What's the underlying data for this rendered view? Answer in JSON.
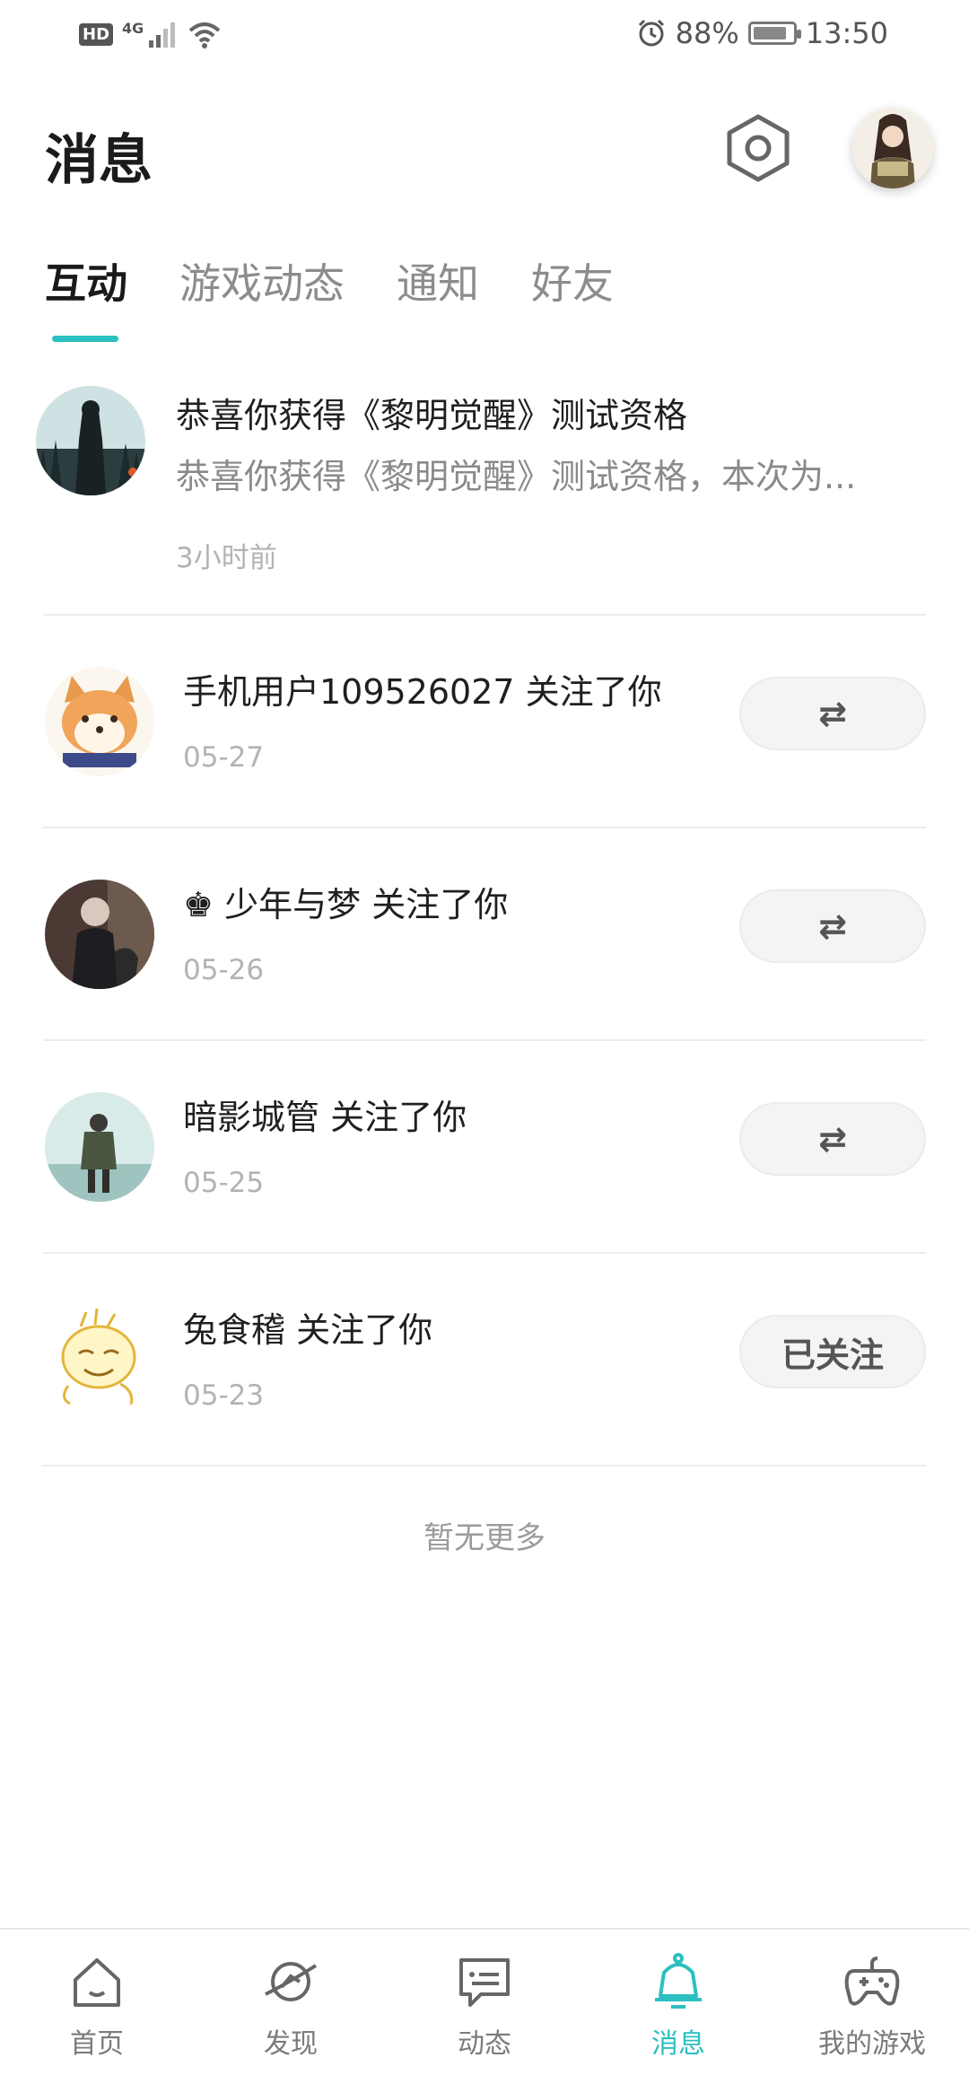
{
  "status_bar": {
    "hd": "HD",
    "network": "4G",
    "battery_percent": "88%",
    "battery_level": 0.88,
    "time": "13:50"
  },
  "header": {
    "title": "消息"
  },
  "tabs": [
    {
      "label": "互动",
      "active": true
    },
    {
      "label": "游戏动态",
      "active": false
    },
    {
      "label": "通知",
      "active": false
    },
    {
      "label": "好友",
      "active": false
    }
  ],
  "messages": [
    {
      "type": "system",
      "title": "恭喜你获得《黎明觉醒》测试资格",
      "subtitle": "恭喜你获得《黎明觉醒》测试资格，本次为...",
      "time": "3小时前"
    },
    {
      "type": "follow",
      "title": "手机用户109526027 关注了你",
      "time": "05-27",
      "button": "⇄",
      "button_icon": "mutual-follow-icon"
    },
    {
      "type": "follow",
      "title": "♚ 少年与梦 关注了你",
      "time": "05-26",
      "button": "⇄",
      "button_icon": "mutual-follow-icon"
    },
    {
      "type": "follow",
      "title": "暗影城管 关注了你",
      "time": "05-25",
      "button": "⇄",
      "button_icon": "mutual-follow-icon"
    },
    {
      "type": "follow",
      "title": "兔食稽 关注了你",
      "time": "05-23",
      "button": "已关注"
    }
  ],
  "end_text": "暂无更多",
  "bottom_nav": [
    {
      "label": "首页",
      "icon": "home-icon",
      "active": false
    },
    {
      "label": "发现",
      "icon": "planet-icon",
      "active": false
    },
    {
      "label": "动态",
      "icon": "feed-icon",
      "active": false
    },
    {
      "label": "消息",
      "icon": "bell-icon",
      "active": true
    },
    {
      "label": "我的游戏",
      "icon": "gamepad-icon",
      "active": false
    }
  ],
  "colors": {
    "accent": "#2bbfc0",
    "text_primary": "#1f1f1f",
    "text_secondary": "#8a8a8a",
    "divider": "#ececec"
  }
}
